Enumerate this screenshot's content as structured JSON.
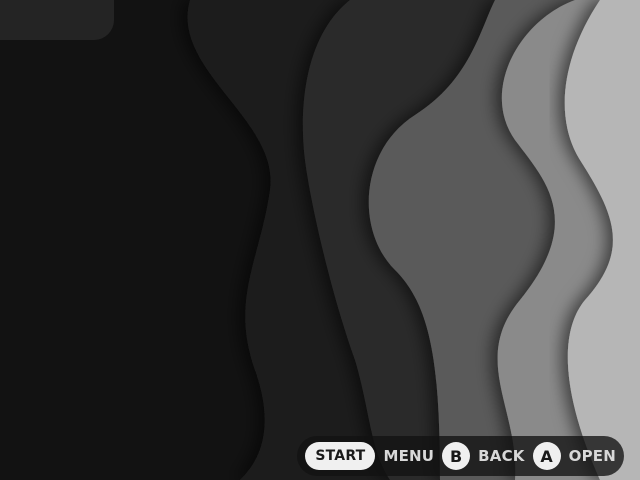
{
  "background": {
    "theme": "wavy-grayscale",
    "layer_colors": [
      "#121212",
      "#1f1f1f",
      "#2b2b2b",
      "#5a5a5a",
      "#8a8a8a",
      "#b6b6b6"
    ]
  },
  "hints": [
    {
      "button": "START",
      "action": "MENU",
      "shape": "pill"
    },
    {
      "button": "B",
      "action": "BACK",
      "shape": "circle"
    },
    {
      "button": "A",
      "action": "OPEN",
      "shape": "circle"
    }
  ]
}
